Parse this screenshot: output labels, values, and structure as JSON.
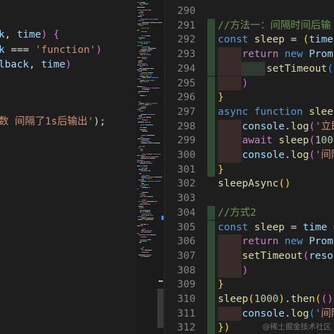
{
  "left_editor": {
    "lines": [
      {
        "segments": [
          {
            "t": "k",
            "c": "var"
          },
          {
            "t": ", ",
            "c": "pun"
          },
          {
            "t": "time",
            "c": "var"
          },
          {
            "t": ") ",
            "c": "br2"
          },
          {
            "t": "{",
            "c": "br2"
          }
        ]
      },
      {
        "segments": [
          {
            "t": "k",
            "c": "var"
          },
          {
            "t": " === ",
            "c": "pun"
          },
          {
            "t": "'function'",
            "c": "str"
          },
          {
            "t": ")",
            "c": "br2"
          }
        ]
      },
      {
        "segments": [
          {
            "t": "lback",
            "c": "var"
          },
          {
            "t": ", ",
            "c": "pun"
          },
          {
            "t": "time",
            "c": "var"
          },
          {
            "t": ")",
            "c": "br2"
          }
        ]
      },
      {
        "segments": [
          {
            "t": "数 间隔了1s后输出'",
            "c": "str"
          },
          {
            "t": ");",
            "c": "pun"
          }
        ]
      }
    ]
  },
  "right_editor": {
    "line_numbers": [
      "290",
      "291",
      "292",
      "293",
      "294",
      "295",
      "296",
      "297",
      "298",
      "299",
      "300",
      "301",
      "302",
      "303",
      "304",
      "305",
      "306",
      "307",
      "308",
      "309",
      "310",
      "311",
      "312"
    ],
    "lines": [
      {
        "segments": []
      },
      {
        "segments": [
          {
            "t": "//方法一：间隔时间后输",
            "c": "cmt"
          }
        ]
      },
      {
        "segments": [
          {
            "t": "const ",
            "c": "kw"
          },
          {
            "t": "sleep",
            "c": "fn"
          },
          {
            "t": " = ",
            "c": "pun"
          },
          {
            "t": "(",
            "c": "br1"
          },
          {
            "t": "time",
            "c": "var"
          },
          {
            "t": ")",
            "c": "br1"
          },
          {
            "t": " =",
            "c": "pun"
          }
        ]
      },
      {
        "segments": [
          {
            "t": "    return ",
            "c": "ctl"
          },
          {
            "t": "new ",
            "c": "kw"
          },
          {
            "t": "Promi",
            "c": "var"
          }
        ]
      },
      {
        "segments": [
          {
            "t": "        setTimeout",
            "c": "fn"
          },
          {
            "t": "(",
            "c": "br3"
          },
          {
            "t": "r",
            "c": "var"
          }
        ]
      },
      {
        "segments": [
          {
            "t": "    )",
            "c": "br2"
          }
        ]
      },
      {
        "segments": [
          {
            "t": "}",
            "c": "br1"
          }
        ]
      },
      {
        "segments": [
          {
            "t": "async ",
            "c": "kw"
          },
          {
            "t": "function ",
            "c": "kw"
          },
          {
            "t": "sleepA",
            "c": "fn"
          }
        ]
      },
      {
        "segments": [
          {
            "t": "    console",
            "c": "var"
          },
          {
            "t": ".",
            "c": "pun"
          },
          {
            "t": "log",
            "c": "fn"
          },
          {
            "t": "(",
            "c": "br2"
          },
          {
            "t": "'立即",
            "c": "str"
          }
        ]
      },
      {
        "segments": [
          {
            "t": "    await ",
            "c": "ctl"
          },
          {
            "t": "sleep",
            "c": "fn"
          },
          {
            "t": "(",
            "c": "br2"
          },
          {
            "t": "1000",
            "c": "num"
          }
        ]
      },
      {
        "segments": [
          {
            "t": "    console",
            "c": "var"
          },
          {
            "t": ".",
            "c": "pun"
          },
          {
            "t": "log",
            "c": "fn"
          },
          {
            "t": "(",
            "c": "br2"
          },
          {
            "t": "'间隔",
            "c": "str"
          }
        ]
      },
      {
        "segments": [
          {
            "t": "}",
            "c": "br1"
          }
        ]
      },
      {
        "segments": [
          {
            "t": "sleepAsync",
            "c": "fn"
          },
          {
            "t": "()",
            "c": "br1"
          }
        ]
      },
      {
        "segments": []
      },
      {
        "segments": [
          {
            "t": "//方式2",
            "c": "cmt"
          }
        ]
      },
      {
        "segments": [
          {
            "t": "const ",
            "c": "kw"
          },
          {
            "t": "sleep",
            "c": "fn"
          },
          {
            "t": " = ",
            "c": "pun"
          },
          {
            "t": "time",
            "c": "var"
          },
          {
            "t": " =",
            "c": "pun"
          }
        ]
      },
      {
        "segments": [
          {
            "t": "    return ",
            "c": "ctl"
          },
          {
            "t": "new ",
            "c": "kw"
          },
          {
            "t": "Promi",
            "c": "var"
          }
        ]
      },
      {
        "segments": [
          {
            "t": "    setTimeout",
            "c": "fn"
          },
          {
            "t": "(",
            "c": "br2"
          },
          {
            "t": "resol",
            "c": "var"
          }
        ]
      },
      {
        "segments": [
          {
            "t": "    )",
            "c": "br2"
          }
        ]
      },
      {
        "segments": [
          {
            "t": "}",
            "c": "br1"
          }
        ]
      },
      {
        "segments": [
          {
            "t": "sleep",
            "c": "fn"
          },
          {
            "t": "(",
            "c": "br1"
          },
          {
            "t": "1000",
            "c": "num"
          },
          {
            "t": ")",
            "c": "br1"
          },
          {
            "t": ".",
            "c": "pun"
          },
          {
            "t": "then",
            "c": "fn"
          },
          {
            "t": "(",
            "c": "br1"
          },
          {
            "t": "()",
            "c": "br2"
          }
        ]
      },
      {
        "segments": [
          {
            "t": "    console",
            "c": "var"
          },
          {
            "t": ".",
            "c": "pun"
          },
          {
            "t": "log",
            "c": "fn"
          },
          {
            "t": "(",
            "c": "br3"
          },
          {
            "t": "'间隔",
            "c": "str"
          }
        ]
      },
      {
        "segments": [
          {
            "t": "})",
            "c": "br1"
          }
        ]
      }
    ]
  },
  "watermark": "@稀土掘金技术社区",
  "colors": {
    "background": "#1e1e1e",
    "keyword": "#569cd6",
    "control": "#c586c0",
    "function": "#dcdcaa",
    "variable": "#9cdcfe",
    "number": "#b5cea8",
    "string": "#ce9178",
    "comment": "#6a9955"
  }
}
